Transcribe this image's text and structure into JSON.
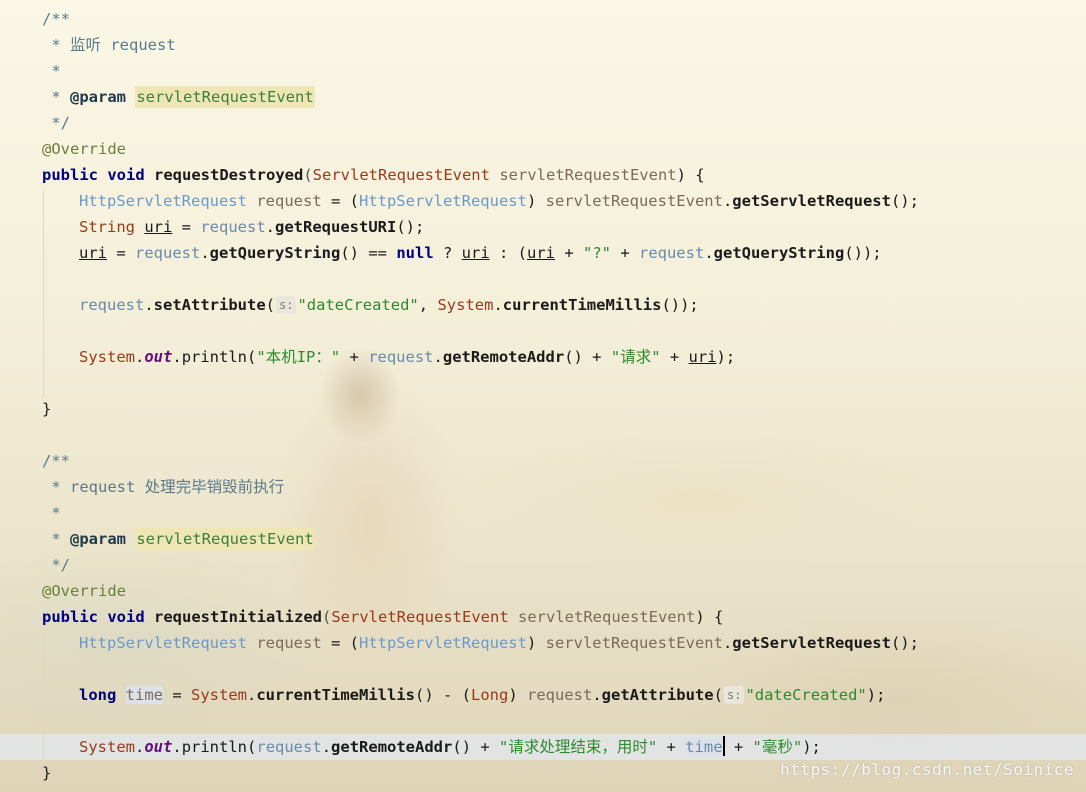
{
  "editor": {
    "lines": [
      {
        "doc": "/**"
      },
      {
        "doc": " * 监听 request"
      },
      {
        "doc": " *"
      },
      {
        "doc_prefix": " * ",
        "tag": "@param",
        "param": "servletRequestEvent"
      },
      {
        "doc": " */"
      },
      {
        "ann": "@Override"
      },
      {
        "kw1": "public",
        "kw2": "void",
        "name": "requestDestroyed",
        "type": "ServletRequestEvent",
        "arg": "servletRequestEvent",
        "tail": ") {"
      },
      {
        "t1": "HttpServletRequest",
        "v1": "request",
        "op1": " = (",
        "t2": "HttpServletRequest",
        "v2": "servletRequestEvent",
        "m": "getServletRequest",
        "tail": "();"
      },
      {
        "t1": "String",
        "v1": "uri",
        "op1": " = ",
        "v2": "request",
        "m": "getRequestURI",
        "tail": "();"
      },
      {
        "v1": "uri",
        "op1": " = ",
        "v2": "request",
        "m": "getQueryString",
        "op2": "() == ",
        "kw": "null",
        "op3": " ? ",
        "v3": "uri",
        "op4": " : (",
        "v4": "uri",
        "op5": " + ",
        "s": "\"?\"",
        "op6": " + ",
        "v5": "request",
        "m2": "getQueryString",
        "tail": "());"
      },
      {},
      {
        "v1": "request",
        "m": "setAttribute",
        "hint": "s:",
        "s": "\"dateCreated\"",
        "op1": ", ",
        "t1": "System",
        "m2": "currentTimeMillis",
        "tail": "());"
      },
      {},
      {
        "t1": "System",
        "f": "out",
        "m": "println",
        "s1": "\"本机IP：\"",
        "op1": " + ",
        "v1": "request",
        "m2": "getRemoteAddr",
        "op2": "() + ",
        "s2": "\"请求\"",
        "op3": " + ",
        "v2": "uri",
        "tail": ");"
      },
      {},
      {
        "tail": "}"
      },
      {},
      {
        "doc": "/**"
      },
      {
        "doc": " * request 处理完毕销毁前执行"
      },
      {
        "doc": " *"
      },
      {
        "doc_prefix": " * ",
        "tag": "@param",
        "param": "servletRequestEvent"
      },
      {
        "doc": " */"
      },
      {
        "ann": "@Override"
      },
      {
        "kw1": "public",
        "kw2": "void",
        "name": "requestInitialized",
        "type": "ServletRequestEvent",
        "arg": "servletRequestEvent",
        "tail": ") {"
      },
      {
        "t1": "HttpServletRequest",
        "v1": "request",
        "op1": " = (",
        "t2": "HttpServletRequest",
        "v2": "servletRequestEvent",
        "m": "getServletRequest",
        "tail": "();"
      },
      {},
      {
        "kw": "long",
        "v1": "time",
        "op1": " = ",
        "t1": "System",
        "m": "currentTimeMillis",
        "op2": "() - (",
        "t2": "Long",
        "op3": ") ",
        "v2": "request",
        "m2": "getAttribute",
        "hint": "s:",
        "s": "\"dateCreated\"",
        "tail": ");"
      },
      {},
      {
        "t1": "System",
        "f": "out",
        "m": "println",
        "op0": "(",
        "v1": "request",
        "m2": "getRemoteAddr",
        "op1": "() + ",
        "s1": "\"请求处理结束，用时\"",
        "op2": " + ",
        "v2": "time",
        "op3": " + ",
        "s2": "\"毫秒\"",
        "tail": ");"
      },
      {
        "tail": "}"
      }
    ]
  },
  "watermark": "https://blog.csdn.net/Soinice"
}
